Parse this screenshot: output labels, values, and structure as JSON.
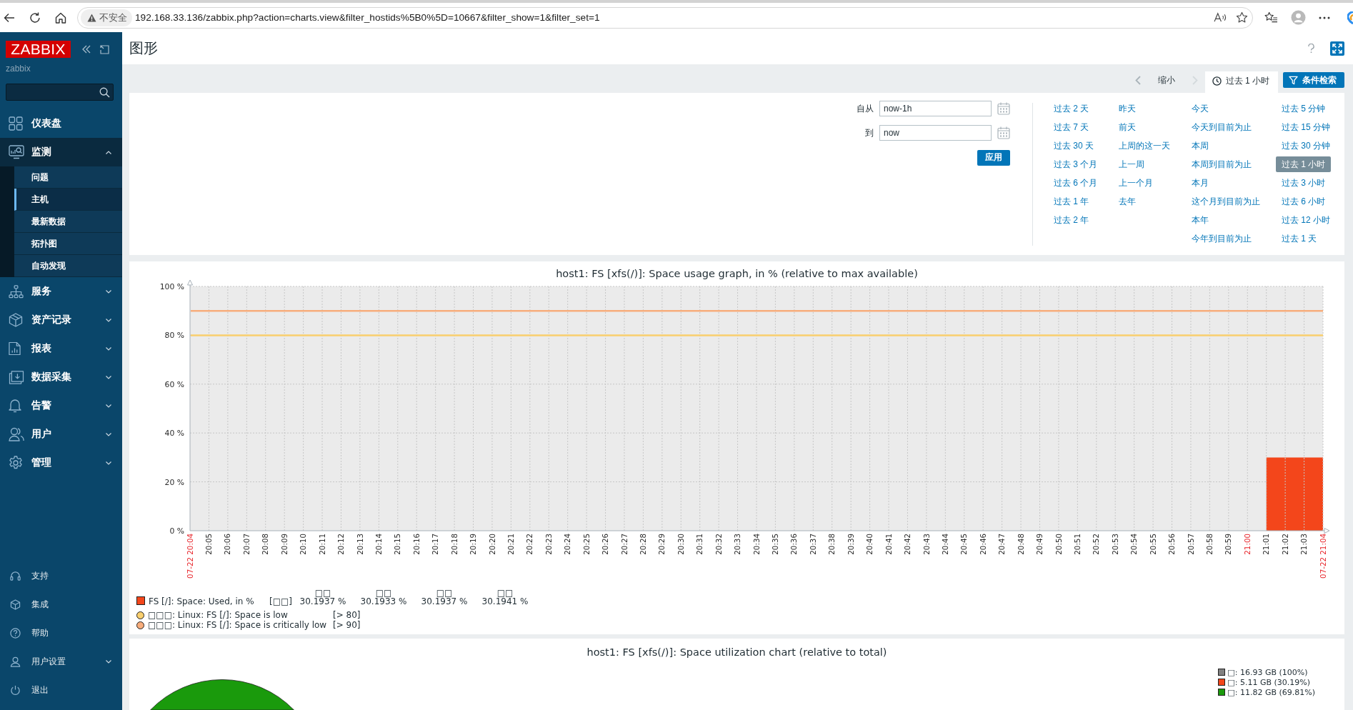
{
  "browser": {
    "security_label": "不安全",
    "url": "192.168.33.136/zabbix.php?action=charts.view&filter_hostids%5B0%5D=10667&filter_show=1&filter_set=1"
  },
  "sidebar": {
    "logo": "ZABBIX",
    "server_name": "zabbix",
    "menu": [
      {
        "label": "仪表盘",
        "kind": "link"
      },
      {
        "label": "监测",
        "kind": "group",
        "expanded": true,
        "children": [
          {
            "label": "问题",
            "selected": false
          },
          {
            "label": "主机",
            "selected": true
          },
          {
            "label": "最新数据",
            "selected": false
          },
          {
            "label": "拓扑图",
            "selected": false
          },
          {
            "label": "自动发现",
            "selected": false
          }
        ]
      },
      {
        "label": "服务",
        "kind": "group",
        "expanded": false
      },
      {
        "label": "资产记录",
        "kind": "group",
        "expanded": false
      },
      {
        "label": "报表",
        "kind": "group",
        "expanded": false
      },
      {
        "label": "数据采集",
        "kind": "group",
        "expanded": false
      },
      {
        "label": "告警",
        "kind": "group",
        "expanded": false
      },
      {
        "label": "用户",
        "kind": "group",
        "expanded": false
      },
      {
        "label": "管理",
        "kind": "group",
        "expanded": false
      }
    ],
    "footer_menu": [
      {
        "label": "支持",
        "kind": "link"
      },
      {
        "label": "集成",
        "kind": "link"
      },
      {
        "label": "帮助",
        "kind": "link"
      },
      {
        "label": "用户设置",
        "kind": "group",
        "expanded": false
      },
      {
        "label": "退出",
        "kind": "link"
      }
    ]
  },
  "header": {
    "title": "图形"
  },
  "filter": {
    "zoom_out": "缩小",
    "tabs": [
      {
        "kind": "time",
        "label": "过去 1 小时",
        "selected": true
      },
      {
        "kind": "filter",
        "label": "条件检索",
        "selected": false
      }
    ],
    "from": {
      "label": "自从",
      "value": "now-1h"
    },
    "to": {
      "label": "到",
      "value": "now"
    },
    "apply": "应用",
    "quick_ranges": [
      [
        {
          "label": "过去 2 天",
          "selected": false
        },
        {
          "label": "过去 7 天",
          "selected": false
        },
        {
          "label": "过去 30 天",
          "selected": false
        },
        {
          "label": "过去 3 个月",
          "selected": false
        },
        {
          "label": "过去 6 个月",
          "selected": false
        },
        {
          "label": "过去 1 年",
          "selected": false
        },
        {
          "label": "过去 2 年",
          "selected": false
        }
      ],
      [
        {
          "label": "昨天",
          "selected": false
        },
        {
          "label": "前天",
          "selected": false
        },
        {
          "label": "上周的这一天",
          "selected": false
        },
        {
          "label": "上一周",
          "selected": false
        },
        {
          "label": "上一个月",
          "selected": false
        },
        {
          "label": "去年",
          "selected": false
        }
      ],
      [
        {
          "label": "今天",
          "selected": false
        },
        {
          "label": "今天到目前为止",
          "selected": false
        },
        {
          "label": "本周",
          "selected": false
        },
        {
          "label": "本周到目前为止",
          "selected": false
        },
        {
          "label": "本月",
          "selected": false
        },
        {
          "label": "这个月到目前为止",
          "selected": false
        },
        {
          "label": "本年",
          "selected": false
        },
        {
          "label": "今年到目前为止",
          "selected": false
        }
      ],
      [
        {
          "label": "过去 5 分钟",
          "selected": false
        },
        {
          "label": "过去 15 分钟",
          "selected": false
        },
        {
          "label": "过去 30 分钟",
          "selected": false
        },
        {
          "label": "过去 1 小时",
          "selected": true
        },
        {
          "label": "过去 3 小时",
          "selected": false
        },
        {
          "label": "过去 6 小时",
          "selected": false
        },
        {
          "label": "过去 12 小时",
          "selected": false
        },
        {
          "label": "过去 1 天",
          "selected": false
        }
      ]
    ]
  },
  "graph": {
    "chart_data": {
      "type": "area",
      "title": "host1: FS [xfs(/)]: Space usage graph, in % (relative to max available)",
      "categories": [
        "07-22 20:04",
        "20:05",
        "20:06",
        "20:07",
        "20:08",
        "20:09",
        "20:10",
        "20:11",
        "20:12",
        "20:13",
        "20:14",
        "20:15",
        "20:16",
        "20:17",
        "20:18",
        "20:19",
        "20:20",
        "20:21",
        "20:22",
        "20:23",
        "20:24",
        "20:25",
        "20:26",
        "20:27",
        "20:28",
        "20:29",
        "20:30",
        "20:31",
        "20:32",
        "20:33",
        "20:34",
        "20:35",
        "20:36",
        "20:37",
        "20:38",
        "20:39",
        "20:40",
        "20:41",
        "20:42",
        "20:43",
        "20:44",
        "20:45",
        "20:46",
        "20:47",
        "20:48",
        "20:49",
        "20:50",
        "20:51",
        "20:52",
        "20:53",
        "20:54",
        "20:55",
        "20:56",
        "20:57",
        "20:58",
        "20:59",
        "21:00",
        "21:01",
        "21:02",
        "21:03",
        "07-22 21:04"
      ],
      "series": [
        {
          "name": "FS [/]: Space: Used, in %",
          "color": "#f3461b",
          "values": [
            null,
            null,
            null,
            null,
            null,
            null,
            null,
            null,
            null,
            null,
            null,
            null,
            null,
            null,
            null,
            null,
            null,
            null,
            null,
            null,
            null,
            null,
            null,
            null,
            null,
            null,
            null,
            null,
            null,
            null,
            null,
            null,
            null,
            null,
            null,
            null,
            null,
            null,
            null,
            null,
            null,
            null,
            null,
            null,
            null,
            null,
            null,
            null,
            null,
            null,
            null,
            null,
            null,
            null,
            null,
            null,
            null,
            30,
            30,
            30,
            30
          ]
        }
      ],
      "ylim": [
        0,
        100
      ],
      "yticks": [
        {
          "value": 0,
          "label": "0 %"
        },
        {
          "value": 20,
          "label": "20 %"
        },
        {
          "value": 40,
          "label": "40 %"
        },
        {
          "value": 60,
          "label": "60 %"
        },
        {
          "value": 80,
          "label": "80 %"
        },
        {
          "value": 100,
          "label": "100 %"
        }
      ],
      "grid": true,
      "ref_lines": [
        {
          "axis": "y",
          "value": 80,
          "color": "#f9cf6e"
        },
        {
          "axis": "y",
          "value": 90,
          "color": "#f7ad7c"
        }
      ]
    },
    "x_label_highlighted": [
      true,
      false,
      false,
      false,
      false,
      false,
      false,
      false,
      false,
      false,
      false,
      false,
      false,
      false,
      false,
      false,
      false,
      false,
      false,
      false,
      false,
      false,
      false,
      false,
      false,
      false,
      false,
      false,
      false,
      false,
      false,
      false,
      false,
      false,
      false,
      false,
      false,
      false,
      false,
      false,
      false,
      false,
      false,
      false,
      false,
      false,
      false,
      false,
      false,
      false,
      false,
      false,
      false,
      false,
      false,
      false,
      true,
      false,
      false,
      false,
      true
    ],
    "legend": {
      "function": "[□□]",
      "stats": [
        {
          "header": "□□",
          "value": "30.1937 %"
        },
        {
          "header": "□□",
          "value": "30.1933 %"
        },
        {
          "header": "□□",
          "value": "30.1937 %"
        },
        {
          "header": "□□",
          "value": "30.1941 %"
        }
      ]
    },
    "triggers": [
      {
        "label": "□□□: Linux: FS [/]: Space is low",
        "condition": "[> 80]"
      },
      {
        "label": "□□□: Linux: FS [/]: Space is critically low",
        "condition": "[> 90]"
      }
    ]
  },
  "pie_panel": {
    "title": "host1: FS [xfs(/)]: Space utilization chart (relative to total)",
    "legend": [
      {
        "label": "□: 16.93 GB (100%)",
        "color": "#808080"
      },
      {
        "label": "□: 5.11 GB (30.19%)",
        "color": "#f3461b"
      },
      {
        "label": "□: 11.82 GB (69.81%)",
        "color": "#1a9a0c"
      }
    ]
  }
}
